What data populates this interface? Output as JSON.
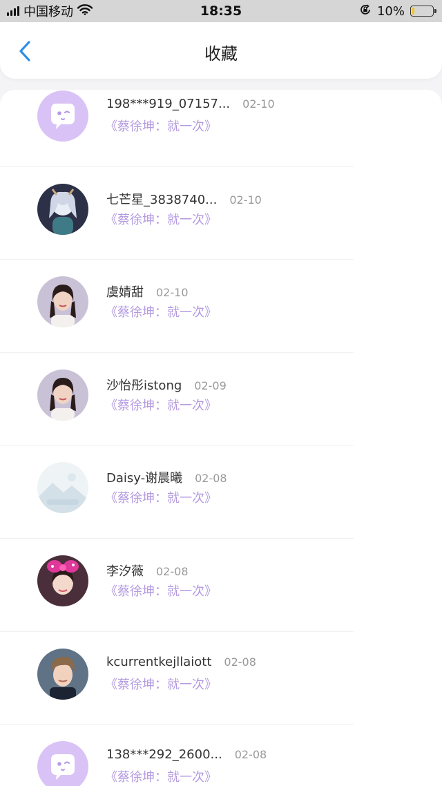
{
  "status_bar": {
    "carrier": "中国移动",
    "time": "18:35",
    "battery": "10%",
    "battery_level": 0.1,
    "icons": [
      "signal-icon",
      "wifi-icon",
      "rotation-lock-icon",
      "battery-icon"
    ]
  },
  "header": {
    "title": "收藏",
    "back_icon": "chevron-left-icon"
  },
  "colors": {
    "accent": "#2d8fe6",
    "song_text": "#b49ae0",
    "default_avatar_bg": "#d9c3f6"
  },
  "items": [
    {
      "name": "198***919_07157...",
      "date": "02-10",
      "song": "《蔡徐坤：就一次》",
      "avatar": "default-chat-avatar"
    },
    {
      "name": "七芒星_3838740...",
      "date": "02-10",
      "song": "《蔡徐坤：就一次》",
      "avatar": "anime-girl-avatar"
    },
    {
      "name": "虞婧甜",
      "date": "02-10",
      "song": "《蔡徐坤：就一次》",
      "avatar": "girl-portrait-avatar"
    },
    {
      "name": "沙怡彤istong",
      "date": "02-09",
      "song": "《蔡徐坤：就一次》",
      "avatar": "girl-portrait-avatar"
    },
    {
      "name": "Daisy-谢晨曦",
      "date": "02-08",
      "song": "《蔡徐坤：就一次》",
      "avatar": "placeholder-image-avatar"
    },
    {
      "name": "李汐薇",
      "date": "02-08",
      "song": "《蔡徐坤：就一次》",
      "avatar": "girl-with-bow-avatar"
    },
    {
      "name": "kcurrentkejllaiott",
      "date": "02-08",
      "song": "《蔡徐坤：就一次》",
      "avatar": "boy-portrait-avatar"
    },
    {
      "name": "138***292_2600...",
      "date": "02-08",
      "song": "《蔡徐坤：就一次》",
      "avatar": "default-chat-avatar"
    }
  ]
}
